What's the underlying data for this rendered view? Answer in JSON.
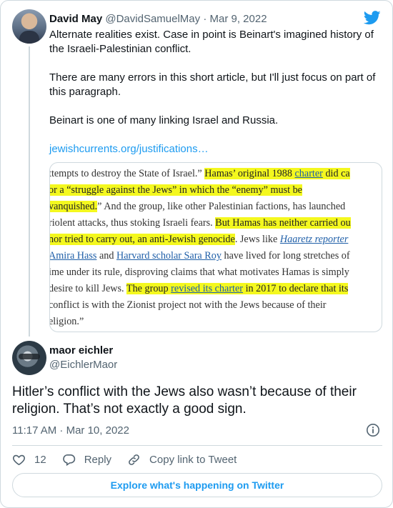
{
  "parent_tweet": {
    "author_name": "David May",
    "author_handle": "@DavidSamuelMay",
    "separator": "·",
    "date": "Mar 9, 2022",
    "paragraphs": [
      "Alternate realities exist. Case in point is Beinart's imagined history of the Israeli-Palestinian conflict.",
      "There are many errors in this short article, but I'll just focus on part of this paragraph.",
      "Beinart is one of many linking Israel and Russia."
    ],
    "link_text": "jewishcurrents.org/justifications…",
    "article_image": {
      "lines": [
        [
          {
            "t": "ttempts to destroy the State of Israel.” ",
            "s": ""
          },
          {
            "t": "Hamas’ original 1988 ",
            "s": "hl"
          },
          {
            "t": "charter",
            "s": "hl ul"
          },
          {
            "t": " did ca",
            "s": "hl"
          }
        ],
        [
          {
            "t": "or a “struggle against the Jews” in which the “enemy” must be",
            "s": "hl"
          }
        ],
        [
          {
            "t": "vanquished.",
            "s": "hl"
          },
          {
            "t": "” And the group, like other Palestinian factions, has launched",
            "s": ""
          }
        ],
        [
          {
            "t": "riolent attacks, thus stoking Israeli fears. ",
            "s": ""
          },
          {
            "t": "But Hamas has neither carried ou",
            "s": "hl"
          }
        ],
        [
          {
            "t": "nor tried to carry out, an anti-Jewish genocide",
            "s": "hl"
          },
          {
            "t": ". Jews like ",
            "s": ""
          },
          {
            "t": "Haaretz reporter",
            "s": "ul em"
          }
        ],
        [
          {
            "t": "Amira Hass",
            "s": "ul"
          },
          {
            "t": " and ",
            "s": ""
          },
          {
            "t": "Harvard scholar Sara Roy",
            "s": "ul"
          },
          {
            "t": " have lived for long stretches of",
            "s": ""
          }
        ],
        [
          {
            "t": "ime under its rule, disproving claims that what motivates Hamas is simply",
            "s": ""
          }
        ],
        [
          {
            "t": " desire to kill Jews. ",
            "s": ""
          },
          {
            "t": "The group ",
            "s": "hl"
          },
          {
            "t": "revised its charter",
            "s": "hl ul"
          },
          {
            "t": " in 2017 to declare that its",
            "s": "hl"
          }
        ],
        [
          {
            "t": "conflict is with the Zionist project not with the Jews because of their",
            "s": ""
          }
        ],
        [
          {
            "t": "eligion.”",
            "s": ""
          }
        ]
      ]
    }
  },
  "reply_tweet": {
    "author_name": "maor eichler",
    "author_handle": "@EichlerMaor",
    "text": "Hitler’s conflict with the Jews also wasn’t because of their religion. That’s not exactly a good sign.",
    "timestamp": "11:17 AM · Mar 10, 2022"
  },
  "actions": {
    "like_count": "12",
    "reply_label": "Reply",
    "copy_link_label": "Copy link to Tweet"
  },
  "cta_label": "Explore what's happening on Twitter",
  "colors": {
    "twitter_blue": "#1d9bf0",
    "text_primary": "#0f1419",
    "text_secondary": "#536471",
    "highlight": "#f4f81e",
    "border": "#cfd9de"
  },
  "icons": [
    "twitter-bird-icon",
    "info-icon",
    "heart-icon",
    "reply-icon",
    "link-icon"
  ]
}
